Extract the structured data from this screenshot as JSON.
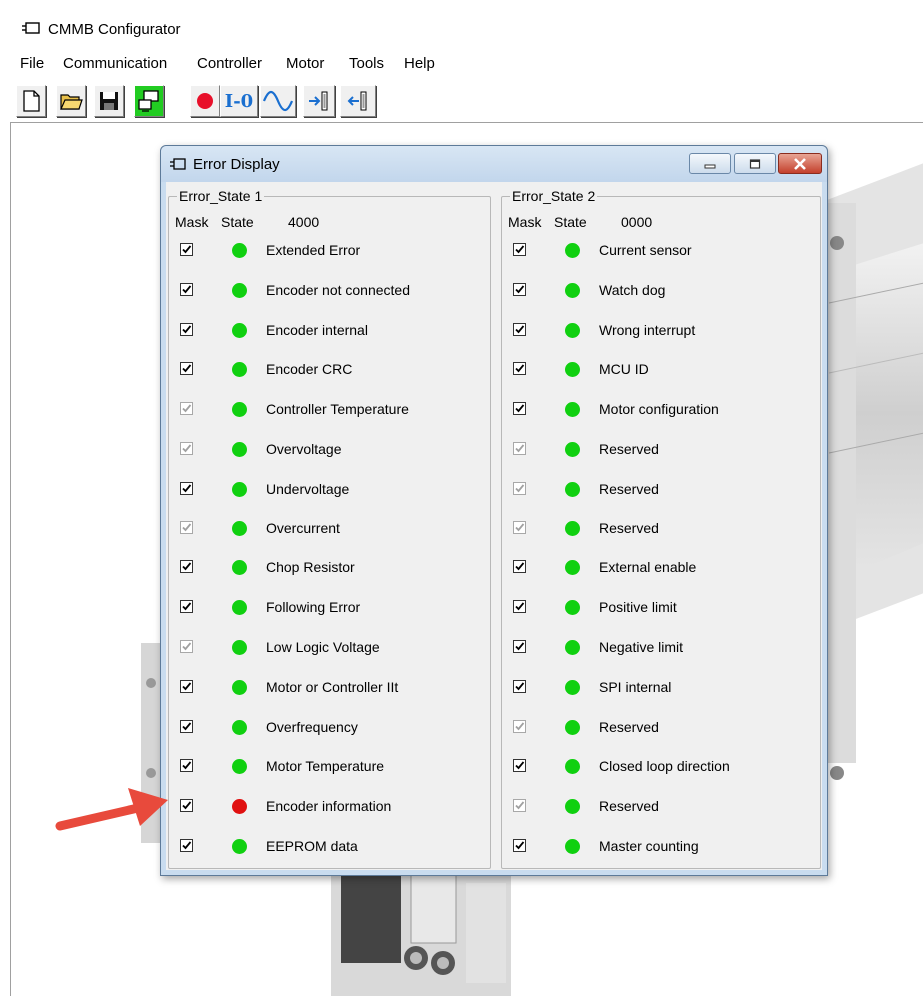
{
  "app": {
    "title": "CMMB Configurator"
  },
  "menu": [
    "File",
    "Communication",
    "Controller",
    "Motor",
    "Tools",
    "Help"
  ],
  "toolbar": {
    "io_label": "I-0"
  },
  "dialog": {
    "title": "Error Display",
    "groups": [
      {
        "label": "Error_State 1",
        "mask_header": "Mask",
        "state_header": "State",
        "value": "4000",
        "rows": [
          {
            "label": "Extended Error",
            "enabled": true,
            "checked": true,
            "state": "ok"
          },
          {
            "label": "Encoder not connected",
            "enabled": true,
            "checked": true,
            "state": "ok"
          },
          {
            "label": "Encoder internal",
            "enabled": true,
            "checked": true,
            "state": "ok"
          },
          {
            "label": "Encoder CRC",
            "enabled": true,
            "checked": true,
            "state": "ok"
          },
          {
            "label": "Controller Temperature",
            "enabled": false,
            "checked": true,
            "state": "ok"
          },
          {
            "label": "Overvoltage",
            "enabled": false,
            "checked": true,
            "state": "ok"
          },
          {
            "label": "Undervoltage",
            "enabled": true,
            "checked": true,
            "state": "ok"
          },
          {
            "label": "Overcurrent",
            "enabled": false,
            "checked": true,
            "state": "ok"
          },
          {
            "label": "Chop Resistor",
            "enabled": true,
            "checked": true,
            "state": "ok"
          },
          {
            "label": "Following Error",
            "enabled": true,
            "checked": true,
            "state": "ok"
          },
          {
            "label": "Low Logic Voltage",
            "enabled": false,
            "checked": true,
            "state": "ok"
          },
          {
            "label": "Motor or Controller IIt",
            "enabled": true,
            "checked": true,
            "state": "ok"
          },
          {
            "label": "Overfrequency",
            "enabled": true,
            "checked": true,
            "state": "ok"
          },
          {
            "label": "Motor Temperature",
            "enabled": true,
            "checked": true,
            "state": "ok"
          },
          {
            "label": "Encoder information",
            "enabled": true,
            "checked": true,
            "state": "error"
          },
          {
            "label": "EEPROM data",
            "enabled": true,
            "checked": true,
            "state": "ok"
          }
        ]
      },
      {
        "label": "Error_State 2",
        "mask_header": "Mask",
        "state_header": "State",
        "value": "0000",
        "rows": [
          {
            "label": "Current sensor",
            "enabled": true,
            "checked": true,
            "state": "ok"
          },
          {
            "label": "Watch dog",
            "enabled": true,
            "checked": true,
            "state": "ok"
          },
          {
            "label": "Wrong interrupt",
            "enabled": true,
            "checked": true,
            "state": "ok"
          },
          {
            "label": "MCU ID",
            "enabled": true,
            "checked": true,
            "state": "ok"
          },
          {
            "label": "Motor configuration",
            "enabled": true,
            "checked": true,
            "state": "ok"
          },
          {
            "label": "Reserved",
            "enabled": false,
            "checked": true,
            "state": "ok"
          },
          {
            "label": "Reserved",
            "enabled": false,
            "checked": true,
            "state": "ok"
          },
          {
            "label": "Reserved",
            "enabled": false,
            "checked": true,
            "state": "ok"
          },
          {
            "label": "External enable",
            "enabled": true,
            "checked": true,
            "state": "ok"
          },
          {
            "label": "Positive limit",
            "enabled": true,
            "checked": true,
            "state": "ok"
          },
          {
            "label": "Negative limit",
            "enabled": true,
            "checked": true,
            "state": "ok"
          },
          {
            "label": "SPI internal",
            "enabled": true,
            "checked": true,
            "state": "ok"
          },
          {
            "label": "Reserved",
            "enabled": false,
            "checked": true,
            "state": "ok"
          },
          {
            "label": "Closed loop direction",
            "enabled": true,
            "checked": true,
            "state": "ok"
          },
          {
            "label": "Reserved",
            "enabled": false,
            "checked": true,
            "state": "ok"
          },
          {
            "label": "Master counting",
            "enabled": true,
            "checked": true,
            "state": "ok"
          }
        ]
      }
    ]
  },
  "colors": {
    "led_ok": "#10d010",
    "led_error": "#e01010",
    "annotation_arrow": "#e84a3c",
    "toolbar_record": "#e8102a",
    "toolbar_blue": "#1a6fd0",
    "toolbar_active_bg": "#22cc22"
  }
}
